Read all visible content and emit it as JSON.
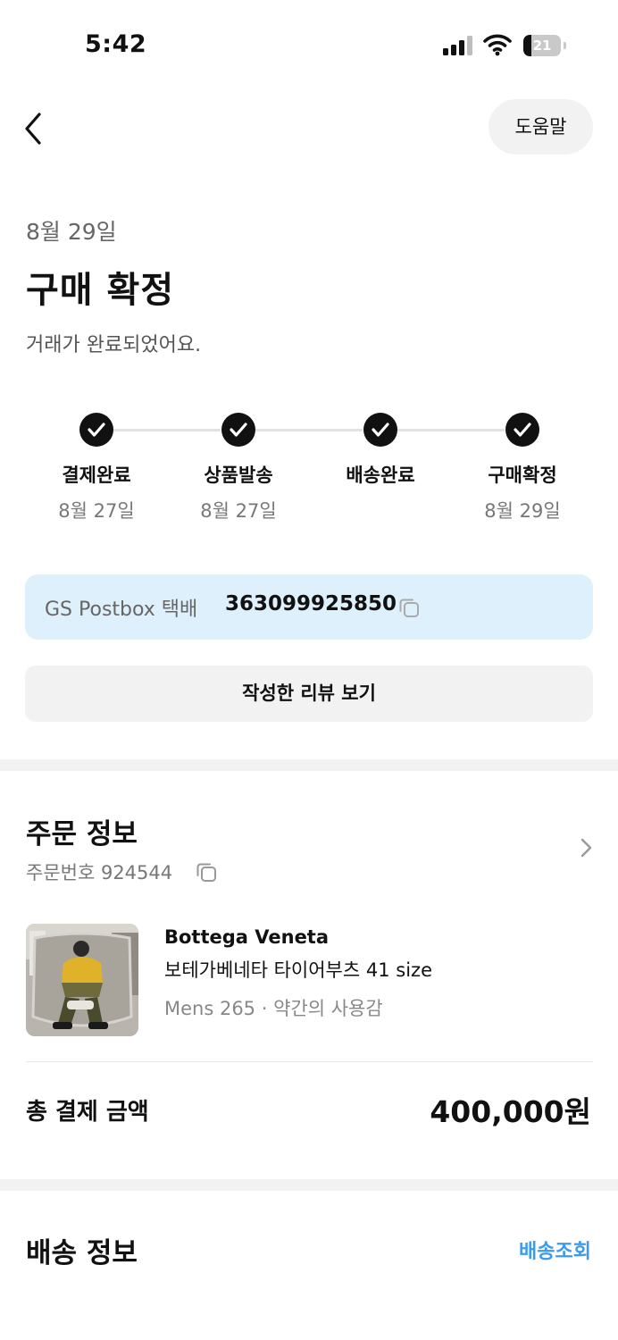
{
  "status_bar": {
    "time": "5:42",
    "battery_level": "21",
    "battery_fraction": 0.21
  },
  "nav": {
    "help_label": "도움말"
  },
  "header": {
    "date": "8월 29일",
    "title": "구매 확정",
    "subtitle": "거래가 완료되었어요."
  },
  "steps": [
    {
      "label": "결제완료",
      "date": "8월 27일",
      "done": true
    },
    {
      "label": "상품발송",
      "date": "8월 27일",
      "done": true
    },
    {
      "label": "배송완료",
      "date": "",
      "done": true
    },
    {
      "label": "구매확정",
      "date": "8월 29일",
      "done": true
    }
  ],
  "tracking": {
    "carrier": "GS Postbox 택배",
    "number": "363099925850"
  },
  "review_button": {
    "label": "작성한 리뷰 보기"
  },
  "order": {
    "section_title": "주문 정보",
    "order_number_text": "주문번호 924544",
    "product": {
      "brand": "Bottega Veneta",
      "name": "보테가베네타 타이어부츠 41 size",
      "meta": "Mens 265 · 약간의 사용감"
    },
    "total_label": "총 결제 금액",
    "total_value": "400,000원"
  },
  "shipping": {
    "section_title": "배송 정보",
    "track_link": "배송조회"
  },
  "colors": {
    "accent_blue": "#3d9bec",
    "tracking_bg": "#dff0fd",
    "gray_bg": "#f2f2f2"
  }
}
